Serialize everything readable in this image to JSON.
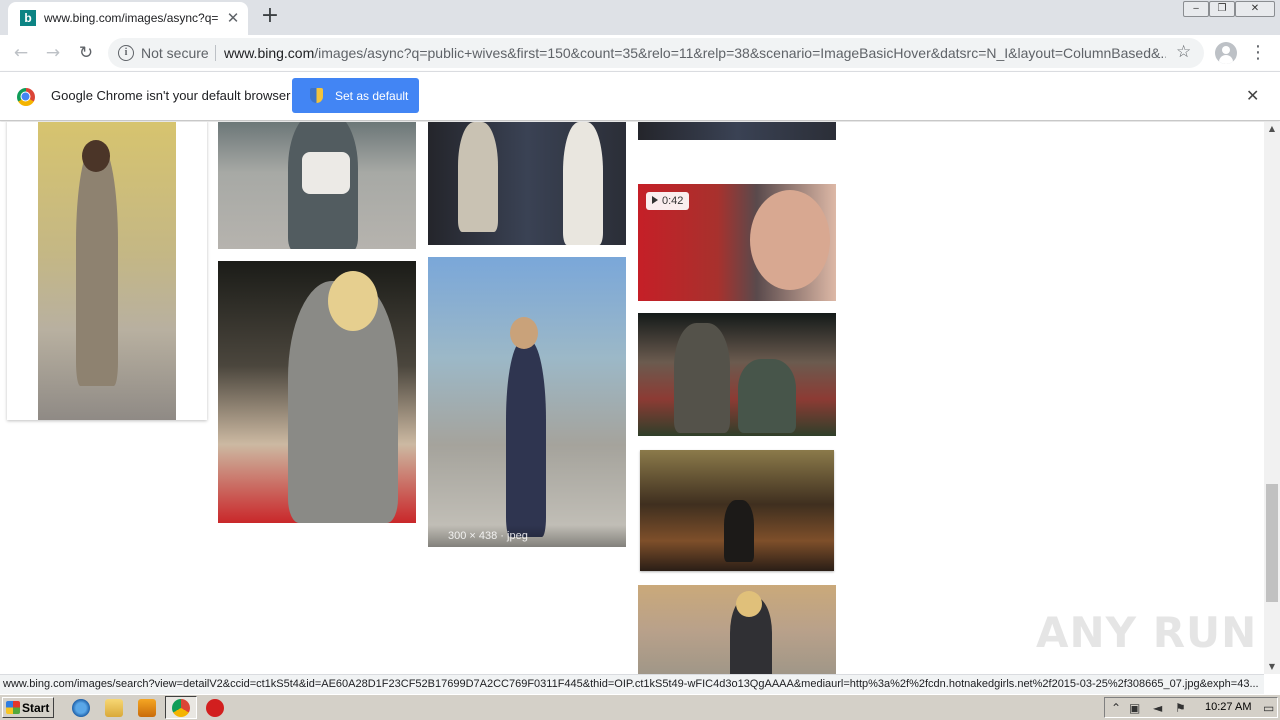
{
  "browser": {
    "tab_title": "www.bing.com/images/async?q=pub",
    "tab_favicon": "b",
    "new_tab_label": "+",
    "close_tab_label": "✕",
    "window_controls": [
      "‒",
      "❐",
      "✕"
    ]
  },
  "toolbar": {
    "back_icon": "←",
    "forward_icon": "→",
    "reload_icon": "↻",
    "security_label": "Not secure",
    "url_host": "www.bing.com",
    "url_path": "/images/async?q=public+wives&first=150&count=35&relo=11&relp=38&scenario=ImageBasicHover&datsrc=N_I&layout=ColumnBased&...",
    "bookmark_icon": "☆",
    "menu_icon": "⋮"
  },
  "infobar": {
    "message": "Google Chrome isn't your default browser",
    "button_label": "Set as default",
    "close_icon": "✕"
  },
  "results": {
    "hover_meta": "300 × 438 · jpeg",
    "video_duration": "0:42"
  },
  "status_url": "www.bing.com/images/search?view=detailV2&ccid=ct1kS5t4&id=AE60A28D1F23CF52B17699D7A2CC769F0311F445&thid=OIP.ct1kS5t49-wFIC4d3o13QgAAAA&mediaurl=http%3a%2f%2fcdn.hotnakedgirls.net%2f2015-03-25%2f308665_07.jpg&exph=43...",
  "watermark": "ANY RUN",
  "taskbar": {
    "start_label": "Start",
    "clock": "10:27 AM"
  },
  "colors": {
    "infobar_button": "#4285f4",
    "tabstrip": "#dee1e6",
    "taskbar": "#d4d0c8"
  }
}
